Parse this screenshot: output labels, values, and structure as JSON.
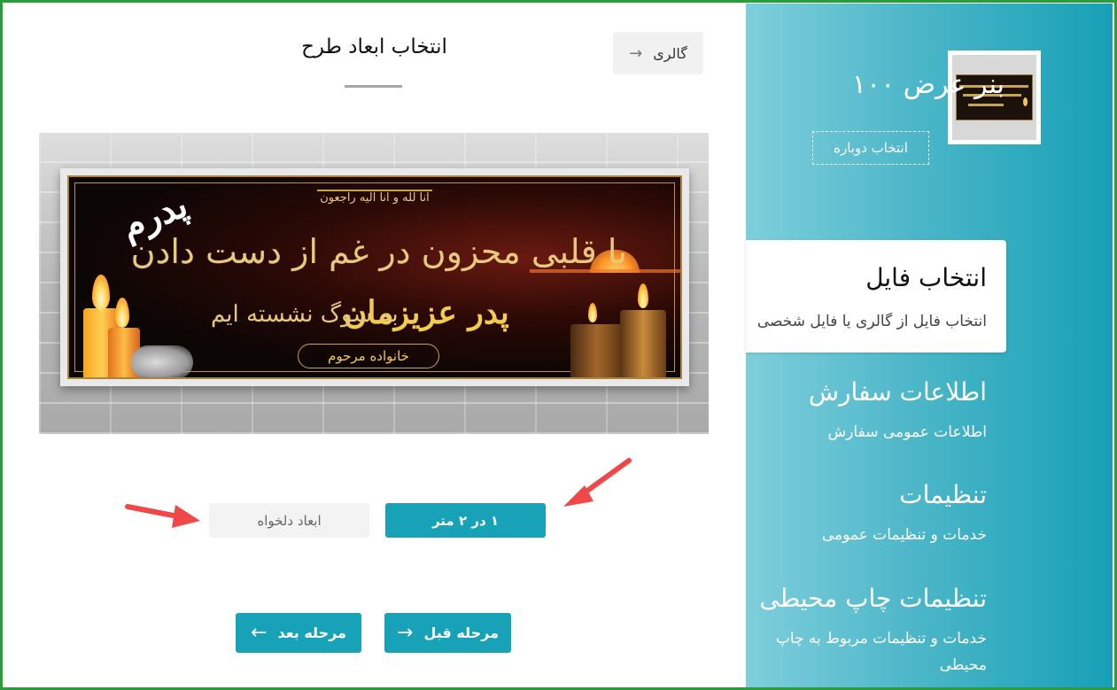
{
  "sidebar": {
    "product_title": "بنر عرض ۱۰۰",
    "reselect_label": "انتخاب دوباره",
    "steps": [
      {
        "title": "انتخاب فایل",
        "desc": "انتخاب فایل از گالری یا فایل شخصی",
        "active": true
      },
      {
        "title": "اطلاعات سفارش",
        "desc": "اطلاعات عمومی سفارش",
        "active": false
      },
      {
        "title": "تنظیمات",
        "desc": "خدمات و تنظیمات عمومی",
        "active": false
      },
      {
        "title": "تنظیمات چاپ محیطی",
        "desc": "خدمات و تنظیمات مربوط به چاپ محیطی",
        "active": false
      }
    ]
  },
  "main": {
    "gallery_label": "گالری",
    "page_title": "انتخاب ابعاد طرح",
    "banner": {
      "top_calligraphy": "انا لله و انا الیه راجعون",
      "side_word": "پدرم",
      "line1": "با قلبی محزون در غم از دست دادن",
      "name": "پدر عزیزمان",
      "line2": "به سوگ نشسته ایم",
      "family": "خانواده مرحوم"
    },
    "size_options": [
      {
        "label": "۱ در ۲ متر",
        "selected": true
      },
      {
        "label": "ابعاد دلخواه",
        "selected": false
      }
    ],
    "nav": {
      "prev_label": "مرحله قبل",
      "next_label": "مرحله بعد"
    }
  },
  "colors": {
    "accent": "#17a2b8",
    "frame_border": "#2a9c3a",
    "annotation_arrow": "#f04848"
  }
}
